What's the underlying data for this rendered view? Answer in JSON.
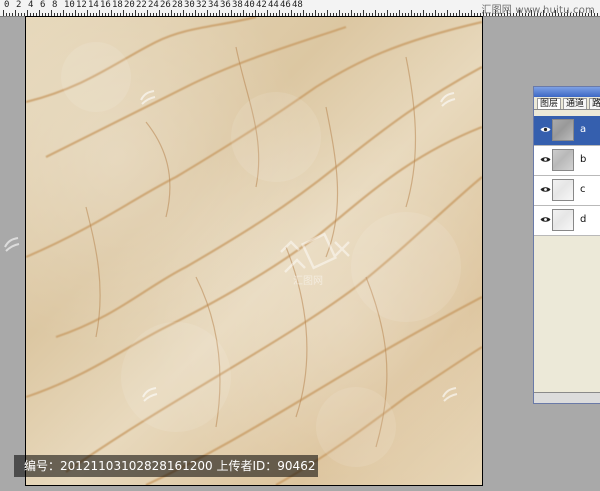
{
  "ruler": {
    "labels": [
      "0",
      "2",
      "4",
      "6",
      "8",
      "10",
      "12",
      "14",
      "16",
      "18",
      "20",
      "22",
      "24",
      "26",
      "28",
      "30",
      "32",
      "34",
      "36",
      "38",
      "40",
      "42",
      "44",
      "46",
      "48"
    ],
    "watermark": "汇图网 www.huitu.com"
  },
  "caption": {
    "text": "编号：20121103102828161200 上传者ID：90462"
  },
  "watermark": {
    "center_text": "汇图网"
  },
  "layers_panel": {
    "tabs": [
      "图层",
      "通道",
      "路"
    ],
    "layers": [
      {
        "name": "a",
        "selected": true
      },
      {
        "name": "b",
        "selected": false
      },
      {
        "name": "c",
        "selected": false
      },
      {
        "name": "d",
        "selected": false
      }
    ]
  },
  "colors": {
    "workspace_gray": "#a9a9a9",
    "panel_selected": "#355fae",
    "marble_base": "#e3d2b1",
    "marble_vein": "#c79a62"
  }
}
